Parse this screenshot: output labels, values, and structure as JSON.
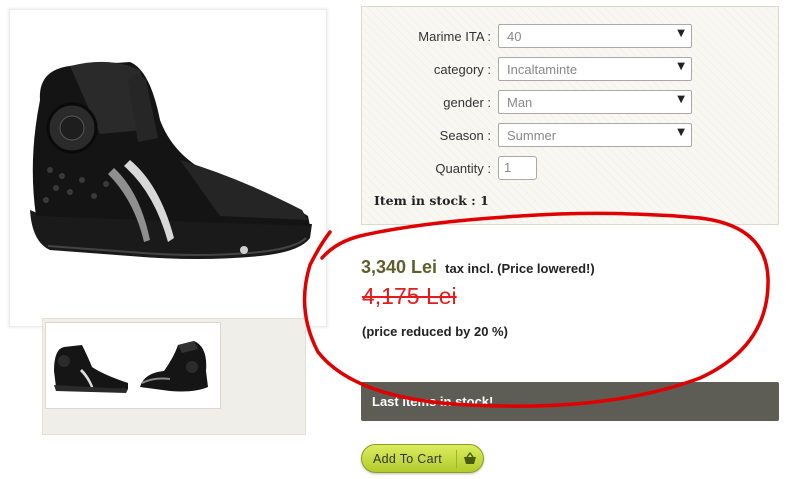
{
  "product": {
    "image_alt": "black racing boot",
    "thumbnails": [
      "boot side view",
      "boot rear view"
    ]
  },
  "attributes": {
    "rows": [
      {
        "label": "Marime ITA :",
        "value": "40"
      },
      {
        "label": "category :",
        "value": "Incaltaminte"
      },
      {
        "label": "gender :",
        "value": "Man"
      },
      {
        "label": "Season :",
        "value": "Summer"
      }
    ],
    "quantity_label": "Quantity :",
    "quantity_value": "1",
    "stock_text": "Item in stock : 1",
    "arrow_icon": "triangle-down-icon"
  },
  "price": {
    "current": "3,340 Lei",
    "tax_note": "tax incl. (Price lowered!)",
    "old": "4,175 Lei",
    "reduction": "(price reduced by 20 %)"
  },
  "last_items": "Last items in stock!",
  "add_to_cart": {
    "label": "Add To Cart",
    "icon": "basket-icon"
  },
  "colors": {
    "price": "#5f5f2d",
    "old_price": "#e51a1a",
    "annotation": "#e00000",
    "cart_button": "#c6de3e",
    "last_items_bar": "#5d5c55"
  }
}
